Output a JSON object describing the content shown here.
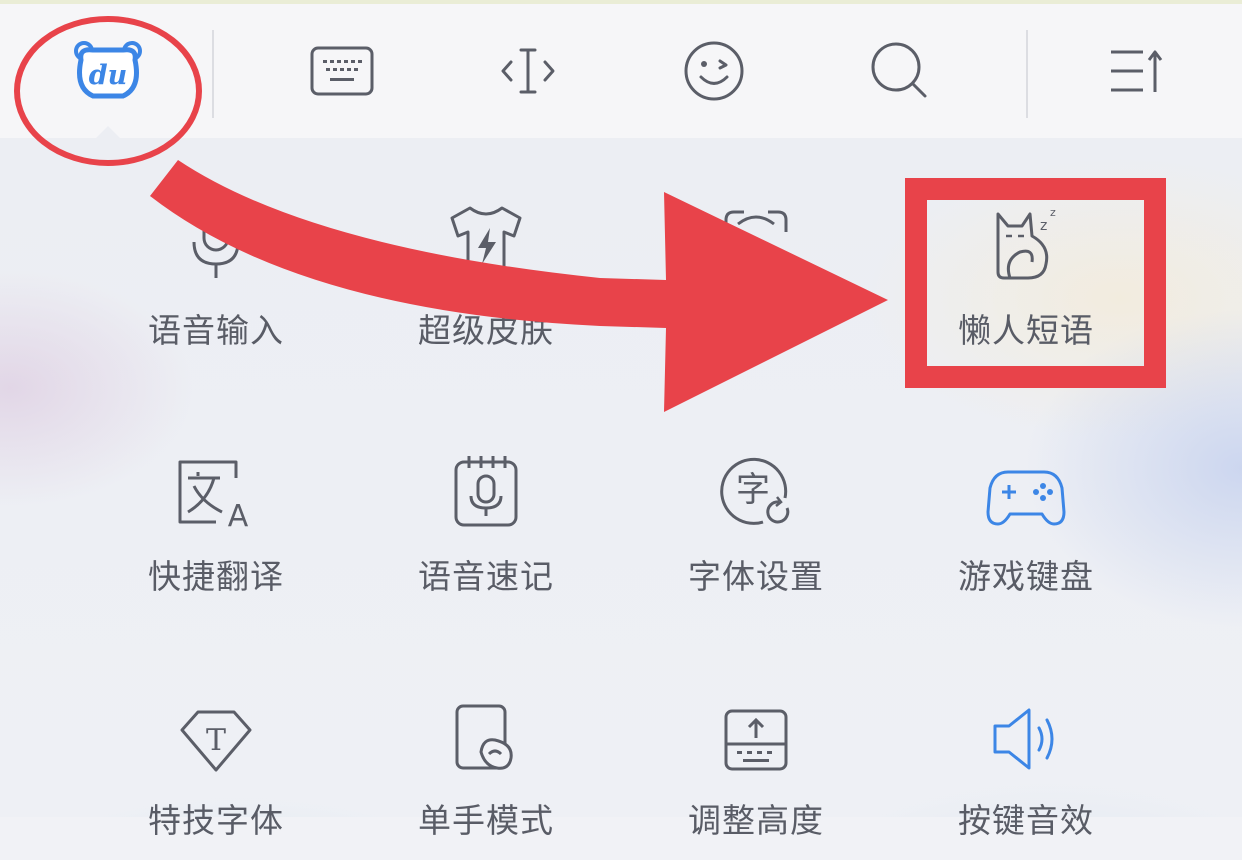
{
  "toolbar": {
    "logo_text": "du",
    "buttons": [
      {
        "icon": "du-bear-logo-icon"
      },
      {
        "icon": "keyboard-icon"
      },
      {
        "icon": "text-cursor-icon"
      },
      {
        "icon": "emoji-icon"
      },
      {
        "icon": "search-icon"
      },
      {
        "icon": "collapse-menu-icon"
      }
    ]
  },
  "grid": {
    "row1": [
      "语音输入",
      "超级皮肤",
      "",
      "懒人短语"
    ],
    "row2": [
      "快捷翻译",
      "语音速记",
      "字体设置",
      "游戏键盘"
    ],
    "row3": [
      "特技字体",
      "单手模式",
      "调整高度",
      "按键音效"
    ]
  },
  "icons": {
    "translate_letter_a": "A",
    "font_glyph": "字",
    "t_glyph": "T",
    "sleep_z": "z"
  },
  "annotation": {
    "color": "#e8434a"
  },
  "colors": {
    "icon_gray": "#5b5e68",
    "icon_blue": "#3c86e6",
    "label_gray": "#595c66"
  }
}
